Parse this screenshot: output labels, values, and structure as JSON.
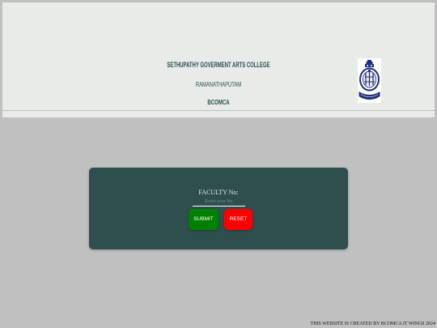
{
  "header": {
    "college_name": "SETHUPATHY GOVERMENT ARTS COLLEGE",
    "location": "RAMANATHAPUTAM",
    "department": "BCOMCA",
    "logo_icon": "college-seal-icon"
  },
  "login_form": {
    "label": "FACULTY No:",
    "input_value": "",
    "input_placeholder": "Enter your No",
    "submit_label": "SUBMIT",
    "reset_label": "RESET"
  },
  "footer": {
    "credit": "THIS WEBSITE IS CREATED BY BCOMCA IT WINGS 2024"
  },
  "colors": {
    "page_background": "#c0c0c0",
    "header_background": "#e8ebe7",
    "header_text": "#2f4f4f",
    "card_background": "#2f4f4f",
    "submit_button": "#008000",
    "reset_button": "#ff0000",
    "logo_navy": "#1f2f7a"
  }
}
